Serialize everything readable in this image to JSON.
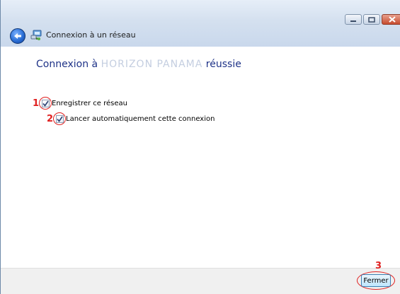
{
  "window": {
    "title": "Connexion à un réseau",
    "buttons": {
      "minimize": "minimize-icon",
      "maximize": "maximize-icon",
      "close": "close-icon"
    },
    "back_icon": "back-arrow-icon",
    "app_icon": "network-icon"
  },
  "main": {
    "heading_prefix": "Connexion à",
    "network_name": "HORIZON PANAMA",
    "heading_suffix": "réussie",
    "options": [
      {
        "marker": "1",
        "label": "Enregistrer ce réseau",
        "checked": true
      },
      {
        "marker": "2",
        "label": "Lancer automatiquement cette connexion",
        "checked": true
      }
    ]
  },
  "footer": {
    "marker": "3",
    "close_label": "Fermer"
  },
  "colors": {
    "heading": "#1e3287",
    "annotation": "#e02020",
    "titlebar": "#d4e0ef",
    "footer": "#f0f0f0"
  }
}
